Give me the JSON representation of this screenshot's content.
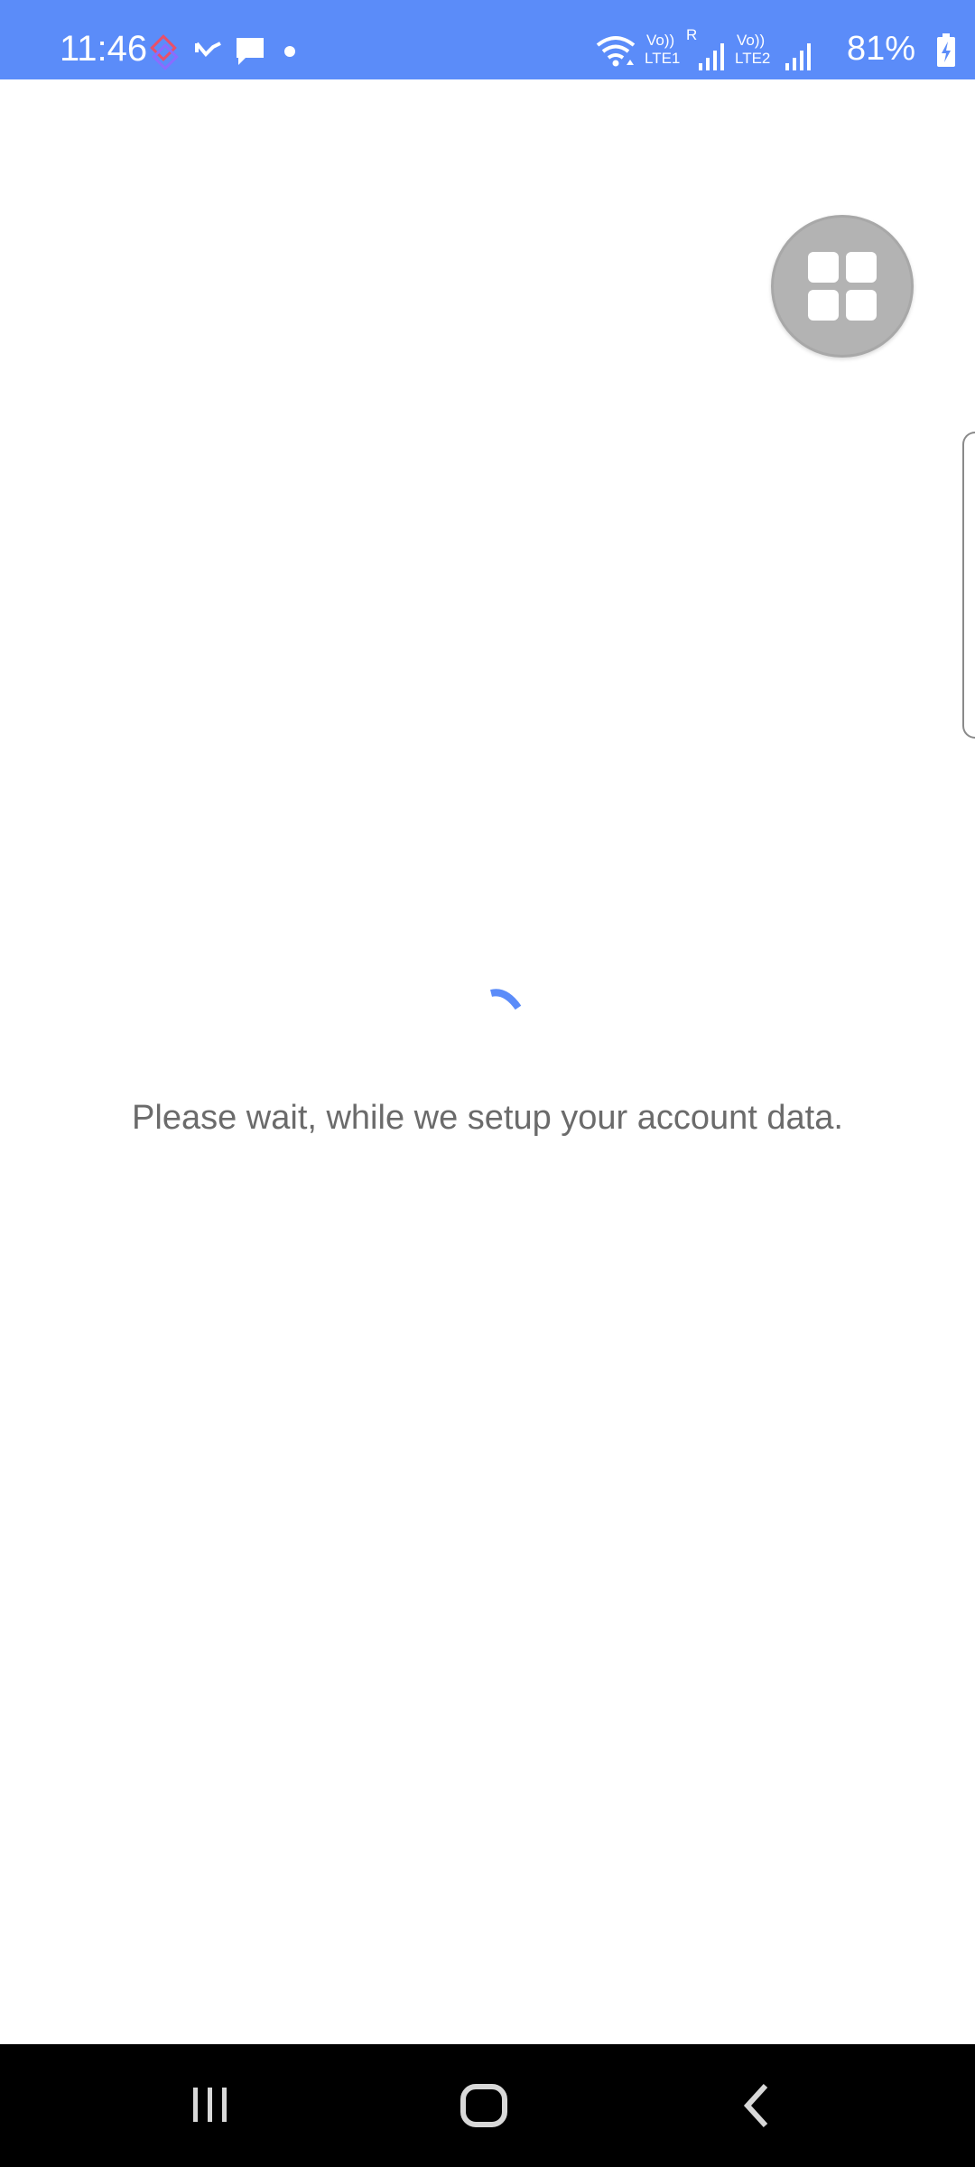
{
  "status_bar": {
    "time": "11:46",
    "battery": "81%",
    "background_color": "#5b8cf9",
    "left_icons": [
      "app-notification-icon",
      "missed-call-icon",
      "message-icon",
      "dot-icon"
    ],
    "right_icons": [
      "wifi-icon",
      "volte-lte1-icon",
      "signal1-icon",
      "volte-lte2-icon",
      "signal2-icon",
      "battery-charging-icon"
    ],
    "sim1": {
      "vo": "Vo))",
      "net": "LTE1",
      "roaming": "R"
    },
    "sim2": {
      "vo": "Vo))",
      "net": "LTE2"
    }
  },
  "fab": {
    "icon": "grid-icon"
  },
  "loading": {
    "message": "Please wait, while we setup your account data.",
    "spinner_color": "#5b8cf9"
  },
  "nav_bar": {
    "icons": [
      "recents-icon",
      "home-icon",
      "back-icon"
    ]
  }
}
